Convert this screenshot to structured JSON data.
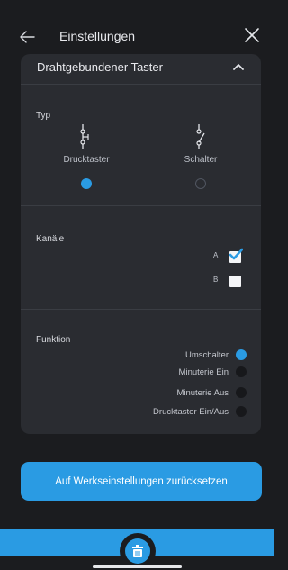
{
  "header": {
    "back_icon": "arrow-left-icon",
    "title": "Einstellungen",
    "close_icon": "close-icon"
  },
  "card": {
    "title": "Drahtgebundener Taster",
    "collapse_icon": "chevron-up-icon",
    "type_section": {
      "label": "Typ",
      "options": [
        {
          "label": "Drucktaster",
          "icon": "push-button-symbol-icon",
          "selected": true
        },
        {
          "label": "Schalter",
          "icon": "switch-symbol-icon",
          "selected": false
        }
      ]
    },
    "channels_section": {
      "label": "Kanäle",
      "channels": [
        {
          "label": "A",
          "checked": true
        },
        {
          "label": "B",
          "checked": false
        }
      ]
    },
    "function_section": {
      "label": "Funktion",
      "options": [
        {
          "label": "Umschalter",
          "selected": true
        },
        {
          "label": "Minuterie Ein",
          "selected": false
        },
        {
          "label": "Minuterie Aus",
          "selected": false
        },
        {
          "label": "Drucktaster Ein/Aus",
          "selected": false
        }
      ]
    }
  },
  "reset_button": {
    "label": "Auf Werkseinstellungen zurücksetzen"
  },
  "bottom_bar": {
    "icon": "trash-icon"
  },
  "colors": {
    "accent": "#2a9be3",
    "background": "#1b1c1f",
    "card": "#2a2c31"
  }
}
